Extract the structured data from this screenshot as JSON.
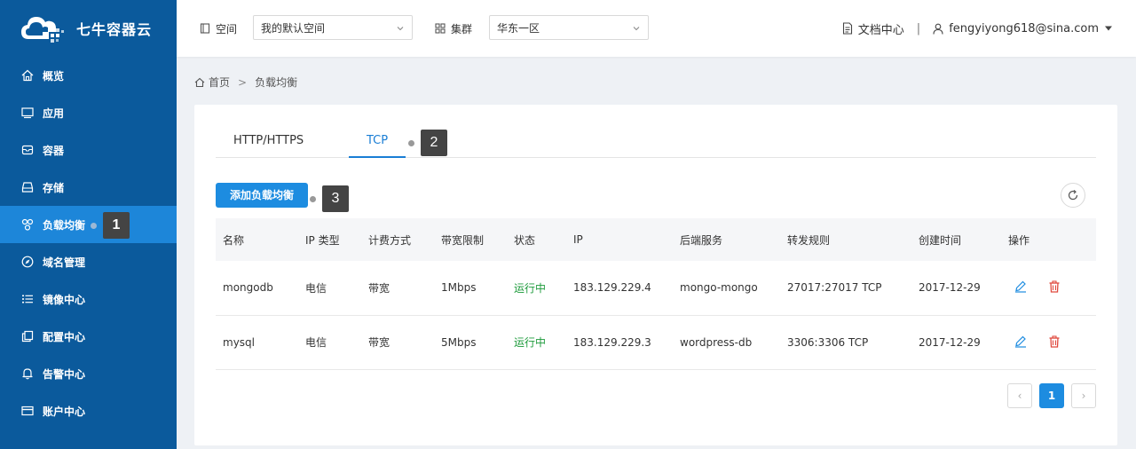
{
  "brand": {
    "name": "七牛容器云"
  },
  "sidebar": {
    "items": [
      {
        "label": "概览",
        "icon": "home-icon"
      },
      {
        "label": "应用",
        "icon": "monitor-icon"
      },
      {
        "label": "容器",
        "icon": "box-icon"
      },
      {
        "label": "存储",
        "icon": "storage-icon"
      },
      {
        "label": "负载均衡",
        "icon": "load-balance-icon",
        "active": true
      },
      {
        "label": "域名管理",
        "icon": "compass-icon"
      },
      {
        "label": "镜像中心",
        "icon": "list-icon"
      },
      {
        "label": "配置中心",
        "icon": "copy-icon"
      },
      {
        "label": "告警中心",
        "icon": "bell-icon"
      },
      {
        "label": "账户中心",
        "icon": "card-icon"
      }
    ]
  },
  "header": {
    "space_label": "空间",
    "space_value": "我的默认空间",
    "cluster_label": "集群",
    "cluster_value": "华东一区",
    "docs_label": "文档中心",
    "separator": "|",
    "user_email": "fengyiyong618@sina.com"
  },
  "breadcrumb": {
    "home": "首页",
    "sep": ">",
    "current": "负载均衡"
  },
  "tabs": [
    {
      "label": "HTTP/HTTPS"
    },
    {
      "label": "TCP",
      "active": true
    }
  ],
  "toolbar": {
    "add_label": "添加负载均衡"
  },
  "table": {
    "columns": [
      "名称",
      "IP 类型",
      "计费方式",
      "带宽限制",
      "状态",
      "IP",
      "后端服务",
      "转发规则",
      "创建时间",
      "操作"
    ],
    "rows": [
      {
        "name": "mongodb",
        "ip_type": "电信",
        "billing": "带宽",
        "bandwidth": "1Mbps",
        "status": "运行中",
        "ip": "183.129.229.4",
        "backend": "mongo-mongo",
        "rule": "27017:27017 TCP",
        "created": "2017-12-29"
      },
      {
        "name": "mysql",
        "ip_type": "电信",
        "billing": "带宽",
        "bandwidth": "5Mbps",
        "status": "运行中",
        "ip": "183.129.229.3",
        "backend": "wordpress-db",
        "rule": "3306:3306 TCP",
        "created": "2017-12-29"
      }
    ]
  },
  "pagination": {
    "prev": "‹",
    "current": "1",
    "next": "›"
  },
  "markers": [
    "1",
    "2",
    "3"
  ],
  "colors": {
    "sidebar": "#0b5a9c",
    "active": "#1d86d9",
    "primary": "#1d8ce0",
    "status_running": "#1e9b3c",
    "delete": "#e04a3f"
  }
}
